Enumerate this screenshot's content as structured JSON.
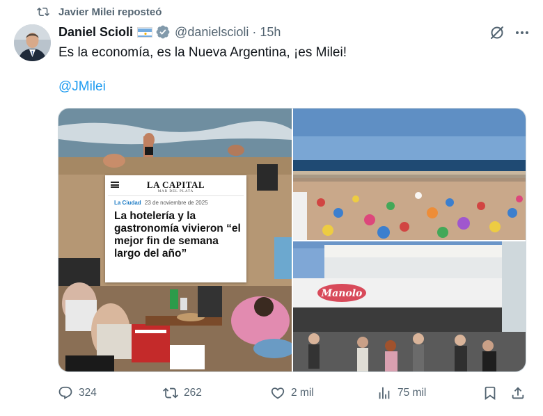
{
  "repost": {
    "icon": "repost-icon",
    "text": "Javier Milei reposteó"
  },
  "author": {
    "display_name": "Daniel Scioli",
    "flag": "argentina-flag-emoji",
    "verified_icon": "verified-badge-icon",
    "handle": "@danielscioli",
    "separator": "·",
    "time": "15h"
  },
  "tweet": {
    "text": "Es la economía, es la Nueva Argentina, ¡es Milei!",
    "mention": "@JMilei"
  },
  "news_card": {
    "logo": "LA CAPITAL",
    "logo_sub": "MAR DEL PLATA",
    "section": "La Ciudad",
    "date": "23 de noviembre de 2025",
    "headline": "La hotelería y la gastronomía vivieron “el mejor fin de semana largo del año”"
  },
  "storefront": {
    "sign": "Manolo"
  },
  "actions": {
    "reply": {
      "icon": "reply-icon",
      "count": "324"
    },
    "repost": {
      "icon": "repost-icon",
      "count": "262"
    },
    "like": {
      "icon": "heart-icon",
      "count": "2 mil"
    },
    "views": {
      "icon": "views-icon",
      "count": "75 mil"
    },
    "bookmark": {
      "icon": "bookmark-icon"
    },
    "share": {
      "icon": "share-icon"
    }
  },
  "colors": {
    "accent": "#1d9bf0",
    "text": "#0f1419",
    "secondary": "#536471",
    "border": "#cfd9de"
  }
}
